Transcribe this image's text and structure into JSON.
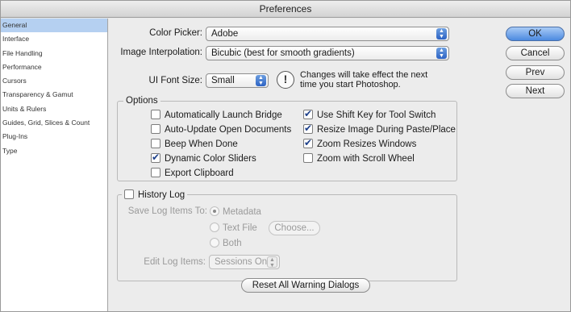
{
  "window": {
    "title": "Preferences"
  },
  "sidebar": {
    "items": [
      {
        "label": "General",
        "selected": true
      },
      {
        "label": "Interface"
      },
      {
        "label": "File Handling"
      },
      {
        "label": "Performance"
      },
      {
        "label": "Cursors"
      },
      {
        "label": "Transparency & Gamut"
      },
      {
        "label": "Units & Rulers"
      },
      {
        "label": "Guides, Grid, Slices & Count"
      },
      {
        "label": "Plug-Ins"
      },
      {
        "label": "Type"
      }
    ]
  },
  "general": {
    "color_picker": {
      "label": "Color Picker:",
      "value": "Adobe"
    },
    "image_interpolation": {
      "label": "Image Interpolation:",
      "value": "Bicubic (best for smooth gradients)"
    },
    "ui_font_size": {
      "label": "UI Font Size:",
      "value": "Small"
    },
    "warning_note": "Changes will take effect the next time you start Photoshop.",
    "options": {
      "title": "Options",
      "checkboxes": [
        {
          "label": "Automatically Launch Bridge",
          "checked": false
        },
        {
          "label": "Auto-Update Open Documents",
          "checked": false
        },
        {
          "label": "Beep When Done",
          "checked": false
        },
        {
          "label": "Dynamic Color Sliders",
          "checked": true
        },
        {
          "label": "Export Clipboard",
          "checked": false
        },
        {
          "label": "Use Shift Key for Tool Switch",
          "checked": true
        },
        {
          "label": "Resize Image During Paste/Place",
          "checked": true
        },
        {
          "label": "Zoom Resizes Windows",
          "checked": true
        },
        {
          "label": "Zoom with Scroll Wheel",
          "checked": false
        }
      ]
    },
    "history_log": {
      "title": "History Log",
      "checked": false,
      "save_log_label": "Save Log Items To:",
      "radio_options": [
        "Metadata",
        "Text File",
        "Both"
      ],
      "selected_radio": "Metadata",
      "choose_button": "Choose...",
      "edit_log_label": "Edit Log Items:",
      "edit_log_value": "Sessions Only"
    },
    "reset_button": "Reset All Warning Dialogs"
  },
  "buttons": {
    "ok": "OK",
    "cancel": "Cancel",
    "prev": "Prev",
    "next": "Next"
  }
}
